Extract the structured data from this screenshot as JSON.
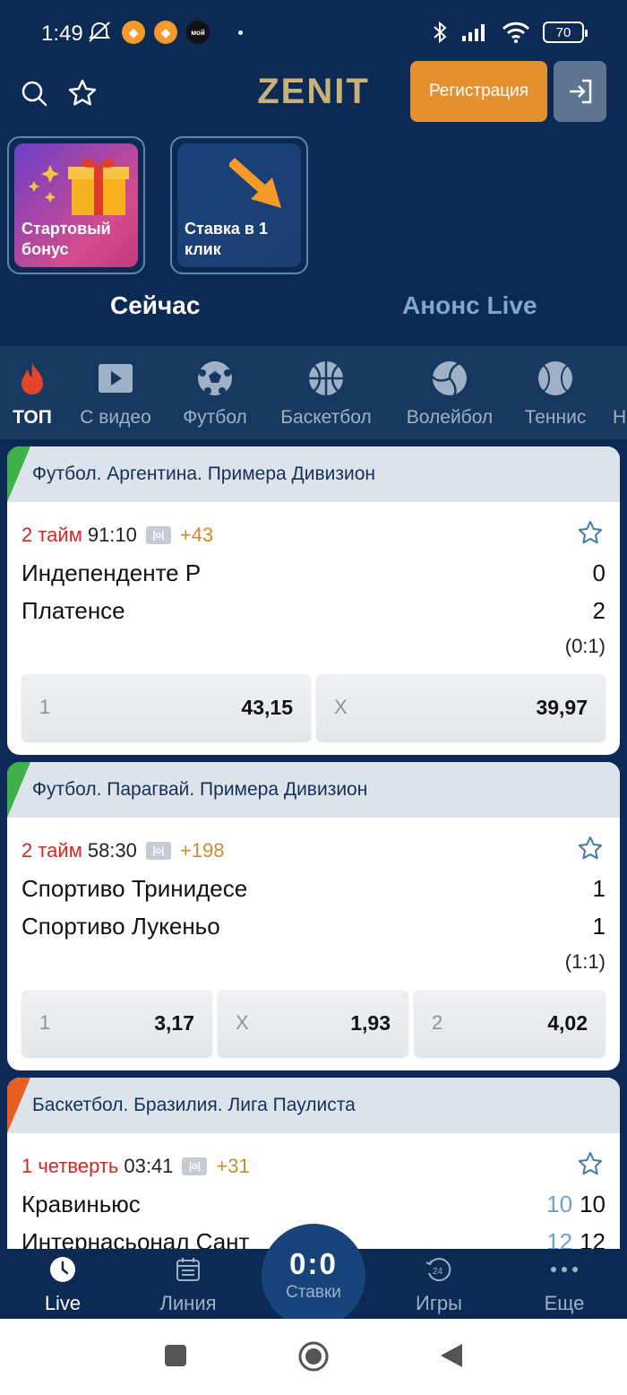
{
  "status_bar": {
    "time": "1:49",
    "battery": "70",
    "apps": [
      "app-icon-1",
      "app-icon-2",
      "мой"
    ]
  },
  "header": {
    "logo": "ZENIT",
    "register_label": "Регистрация"
  },
  "stories": [
    {
      "label": "Стартовый бонус"
    },
    {
      "label": "Ставка в 1 клик"
    }
  ],
  "tabs": {
    "now": "Сейчас",
    "anons": "Анонс Live"
  },
  "sports": [
    {
      "label": "ТОП",
      "icon": "fire-icon"
    },
    {
      "label": "С видео",
      "icon": "video-icon"
    },
    {
      "label": "Футбол",
      "icon": "football-icon"
    },
    {
      "label": "Баскетбол",
      "icon": "basketball-icon"
    },
    {
      "label": "Волейбол",
      "icon": "volleyball-icon"
    },
    {
      "label": "Теннис",
      "icon": "tennis-icon"
    },
    {
      "label": "Н",
      "icon": ""
    }
  ],
  "matches": [
    {
      "league": "Футбол. Аргентина. Примера Дивизион",
      "period": "2 тайм",
      "clock": "91:10",
      "more": "+43",
      "team1": "Индепенденте Р",
      "team2": "Платенсе",
      "score1": "0",
      "score2": "2",
      "half": "(0:1)",
      "odds": [
        {
          "k": "1",
          "v": "43,15"
        },
        {
          "k": "X",
          "v": "39,97"
        }
      ]
    },
    {
      "league": "Футбол. Парагвай. Примера Дивизион",
      "period": "2 тайм",
      "clock": "58:30",
      "more": "+198",
      "team1": "Спортиво Тринидесе",
      "team2": "Спортиво Лукеньо",
      "score1": "1",
      "score2": "1",
      "half": "(1:1)",
      "odds": [
        {
          "k": "1",
          "v": "3,17"
        },
        {
          "k": "X",
          "v": "1,93"
        },
        {
          "k": "2",
          "v": "4,02"
        }
      ]
    },
    {
      "league": "Баскетбол. Бразилия. Лига Паулиста",
      "period": "1 четверть",
      "clock": "03:41",
      "more": "+31",
      "team1": "Кравиньюс",
      "team2": "Интернасьонал Сант",
      "score1_prev": "10",
      "score1": "10",
      "score2_prev": "12",
      "score2": "12"
    }
  ],
  "bottom_nav": {
    "live": "Live",
    "line": "Линия",
    "bets_score": "0:0",
    "bets": "Ставки",
    "games": "Игры",
    "more": "Еще"
  },
  "colors": {
    "bg": "#0c2a54",
    "accent": "#e3912e",
    "logo": "#c9b27a",
    "live_period": "#d02727"
  }
}
